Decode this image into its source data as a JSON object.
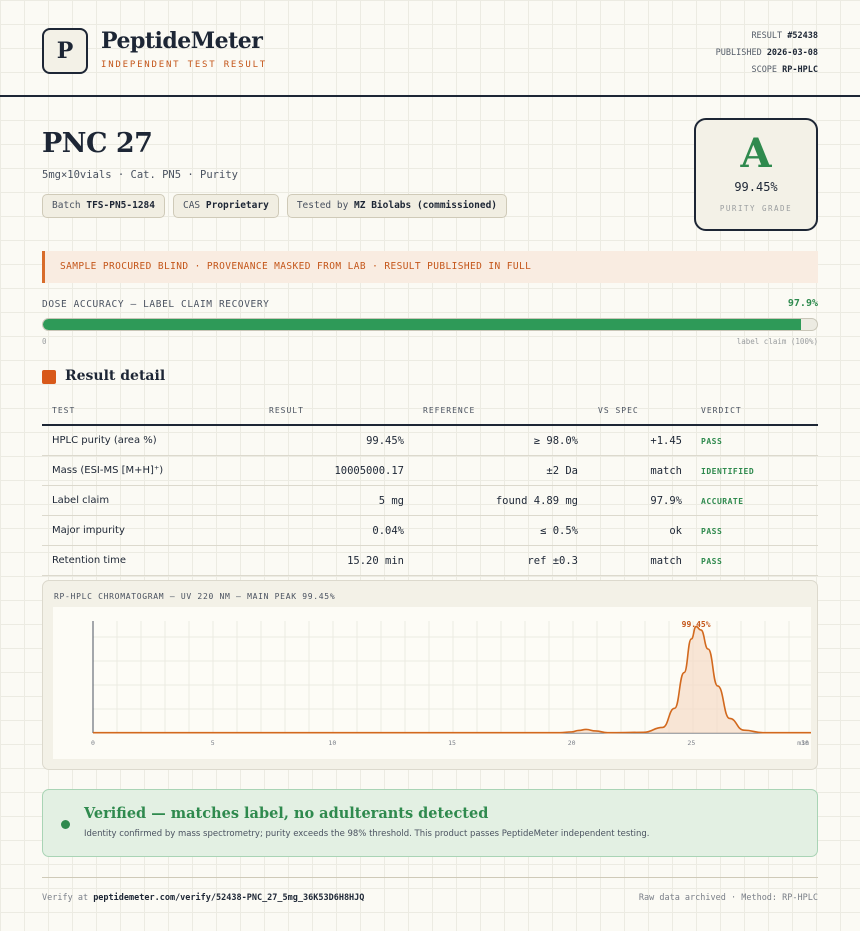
{
  "header": {
    "logo_letter": "P",
    "brand": "PeptideMeter",
    "tagline": "INDEPENDENT TEST RESULT",
    "result_label": "RESULT",
    "result_id": "#52438",
    "published_label": "PUBLISHED",
    "published_date": "2026-03-08",
    "scope_label": "SCOPE",
    "scope_value": "RP-HPLC"
  },
  "product": {
    "name": "PNC 27",
    "subtitle": "5mg×10vials · Cat. PN5 · Purity",
    "chips": [
      {
        "label": "Batch",
        "value": "TFS-PN5-1284"
      },
      {
        "label": "CAS",
        "value": "Proprietary"
      },
      {
        "label": "Tested by",
        "value": "MZ Biolabs (commissioned)"
      }
    ]
  },
  "grade": {
    "letter": "A",
    "value": "99.45%",
    "label": "PURITY GRADE"
  },
  "notice": "SAMPLE PROCURED BLIND · PROVENANCE MASKED FROM LAB · RESULT PUBLISHED IN FULL",
  "dose": {
    "label": "DOSE ACCURACY — LABEL CLAIM RECOVERY",
    "value_text": "97.9%",
    "fraction": 0.979,
    "min_label": "0",
    "max_label": "label claim (100%)"
  },
  "section_title": "Result detail",
  "table": {
    "headers": [
      "TEST",
      "RESULT",
      "REFERENCE",
      "VS SPEC",
      "VERDICT"
    ],
    "rows": [
      {
        "test": "HPLC purity (area %)",
        "result": "99.45%",
        "reference": "≥ 98.0%",
        "vs_spec": "+1.45",
        "verdict": "PASS"
      },
      {
        "test": "Mass (ESI-MS [M+H]⁺)",
        "result": "10005000.17",
        "reference": "±2 Da",
        "vs_spec": "match",
        "verdict": "IDENTIFIED"
      },
      {
        "test": "Label claim",
        "result": "5 mg",
        "reference": "found 4.89 mg",
        "vs_spec": "97.9%",
        "verdict": "ACCURATE"
      },
      {
        "test": "Major impurity",
        "result": "0.04%",
        "reference": "≤ 0.5%",
        "vs_spec": "ok",
        "verdict": "PASS"
      },
      {
        "test": "Retention time",
        "result": "15.20 min",
        "reference": "ref ±0.3",
        "vs_spec": "match",
        "verdict": "PASS"
      }
    ]
  },
  "chart_data": {
    "type": "line",
    "title": "RP-HPLC CHROMATOGRAM — UV 220 NM — MAIN PEAK 99.45%",
    "xlabel": "min",
    "ylabel": "",
    "xlim": [
      0,
      30
    ],
    "x_ticks": [
      0,
      5,
      10,
      15,
      20,
      25,
      30
    ],
    "grid": true,
    "series": [
      {
        "x": [
          0,
          19.5,
          20.0,
          20.3,
          20.6,
          21.0,
          21.5,
          23.0,
          23.8,
          24.3,
          24.7,
          25.0,
          25.2,
          25.4,
          25.7,
          26.1,
          26.6,
          27.2,
          28.0,
          30.0
        ],
        "y": [
          0.3,
          0.3,
          1.0,
          2.3,
          3.2,
          1.8,
          0.3,
          0.6,
          5.0,
          22.0,
          54.0,
          84.0,
          95.0,
          92.0,
          75.0,
          42.0,
          13.0,
          2.5,
          0.3,
          0.3
        ]
      }
    ],
    "peak_annotation": {
      "x": 25.2,
      "label": "99.45%"
    },
    "colors": {
      "line": "#d2691e",
      "fill": "#f5dcc8"
    }
  },
  "verified": {
    "title": "Verified — matches label, no adulterants detected",
    "text": "Identity confirmed by mass spectrometry; purity exceeds the 98% threshold. This product passes PeptideMeter independent testing."
  },
  "footer": {
    "verify_prefix": "Verify at",
    "verify_url": "peptidemeter.com/verify/52438-PNC_27_5mg_36K53D6H8HJQ",
    "right_text": "Raw data archived · Method: RP-HPLC"
  }
}
